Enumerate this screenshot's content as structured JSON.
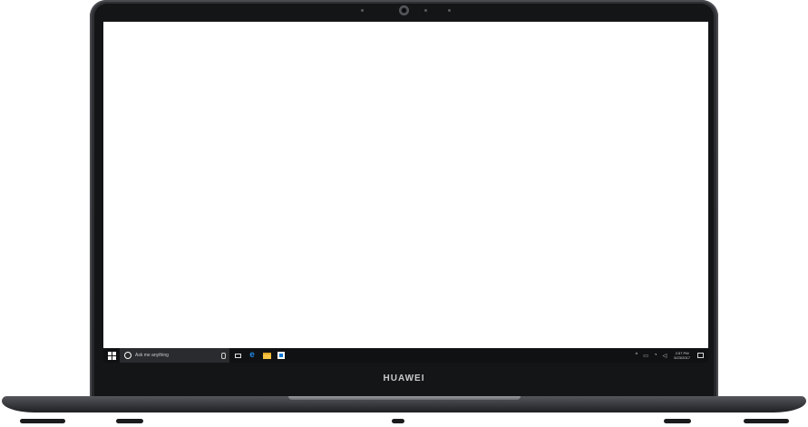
{
  "device": {
    "brand_label": "HUAWEI"
  },
  "taskbar": {
    "search_placeholder": "Ask me anything",
    "start_icon": "windows-logo-icon",
    "pinned_icons": [
      "task-view-icon",
      "edge-icon",
      "file-explorer-icon",
      "store-icon"
    ],
    "tray": {
      "time": "2:57 PM",
      "date": "5/23/2017"
    }
  },
  "colors": {
    "bezel": "#26272a",
    "taskbar": "#101113",
    "edge_blue": "#1e88e5",
    "folder_yellow": "#f6c343",
    "store_blue": "#0078d7"
  }
}
